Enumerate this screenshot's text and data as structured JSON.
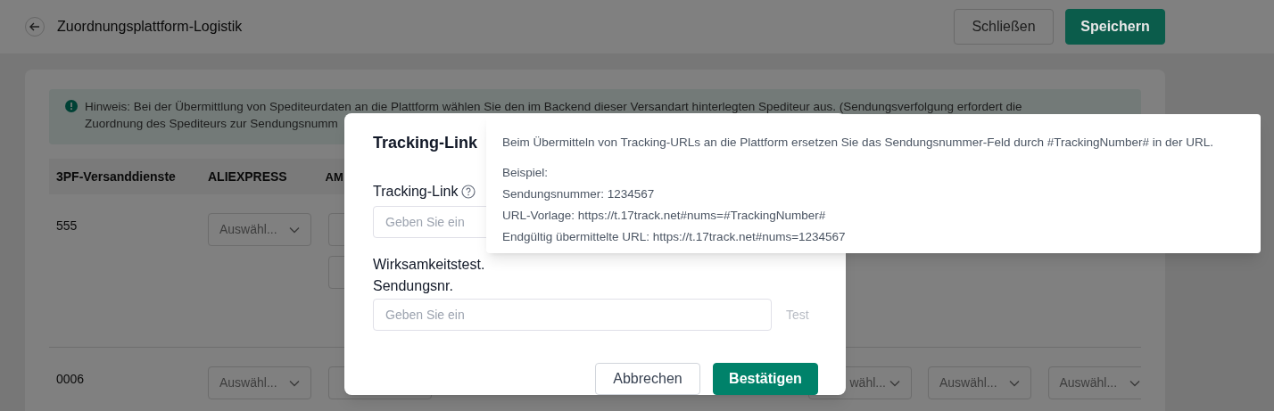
{
  "header": {
    "title": "Zuordnungsplattform-Logistik",
    "buttons": [
      {
        "label": "Schließen",
        "kind": "secondary"
      },
      {
        "label": "Speichern",
        "kind": "primary"
      }
    ]
  },
  "notice": {
    "lines": [
      "Hinweis: Bei der Übermittlung von Spediteurdaten an die Plattform wählen Sie den im Backend dieser Versandart hinterlegten Spediteur aus. (Sendungsverfolgung erfordert die",
      "Zuordnung des Spediteurs zur Sendungsnumm"
    ]
  },
  "table": {
    "columns": [
      "3PF-Versanddienste",
      "ALIEXPRESS",
      "AM"
    ],
    "rows": [
      {
        "cells": [
          "555",
          [
            {
              "kind": "select",
              "text": "Auswähl..."
            }
          ],
          [
            {
              "kind": "select"
            },
            {
              "kind": "select"
            }
          ]
        ],
        "trailing_cells": []
      },
      {
        "cells": [
          "0006",
          [
            {
              "kind": "select",
              "text": "Auswähl..."
            }
          ],
          [
            {
              "kind": "select"
            }
          ]
        ],
        "trailing_cells": [
          [
            {
              "kind": "select",
              "text": "wähl..."
            }
          ],
          [
            {
              "kind": "select",
              "text": "Auswähl..."
            }
          ],
          [
            {
              "kind": "select",
              "text": "Auswähl..."
            }
          ]
        ]
      }
    ]
  },
  "modal": {
    "title": "Tracking-Link",
    "link_field": {
      "label": "Tracking-Link",
      "placeholder": "Geben Sie ein"
    },
    "test_field": {
      "label_lines": [
        "Wirksamkeitstest.",
        "Sendungsnr."
      ],
      "placeholder": "Geben Sie ein"
    },
    "test_action": {
      "label": "Test",
      "disabled": true
    },
    "buttons": [
      {
        "label": "Abbrechen",
        "kind": "secondary"
      },
      {
        "label": "Bestätigen",
        "kind": "primary"
      }
    ]
  },
  "tooltip": {
    "lines": [
      "Beim Übermitteln von Tracking-URLs an die Plattform ersetzen Sie das Sendungsnummer-Feld durch #TrackingNumber# in der URL.",
      "Beispiel:",
      "Sendungsnummer: 1234567",
      "URL-Vorlage: https://t.17track.net#nums=#TrackingNumber#",
      "Endgültig übermittelte URL: https://t.17track.net#nums=1234567"
    ]
  }
}
